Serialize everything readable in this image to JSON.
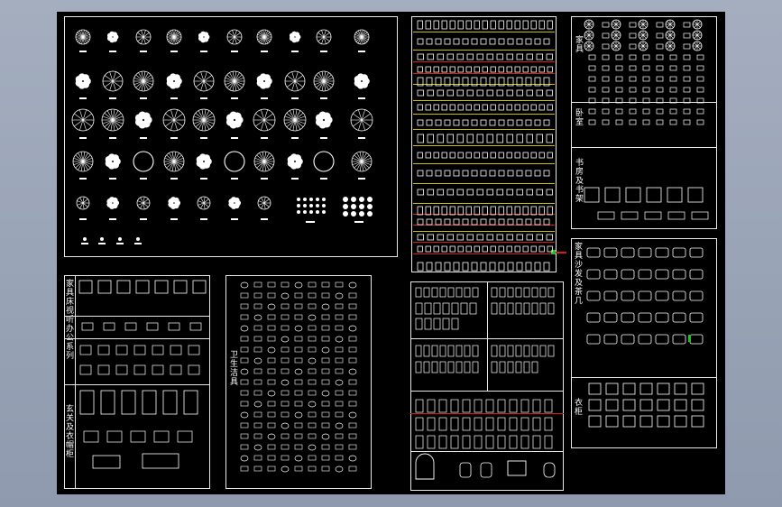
{
  "app": {
    "background": "#a4aebf",
    "canvas_color": "#000000"
  },
  "colors": {
    "line": "#e8e8e8",
    "yellow": "#c9c100",
    "red": "#d21c1c",
    "green": "#20c020"
  },
  "labels": {
    "furniture_top": "家具",
    "bedroom": "卧室",
    "study": "书房及书架",
    "panel_bl": "家具床视听办公系列",
    "panel_bl_lower": "玄关及衣帽柜",
    "sanitary": "卫生洁具",
    "sofa_panel": "家具沙发及茶几",
    "wardrobe": "衣柜"
  },
  "icons": {
    "tree_plan": "tree-symbol-icon",
    "shrub_plan": "shrub-symbol-icon",
    "furniture_block": "furniture-block-icon",
    "door_window": "door-window-icon",
    "bathroom_fixture": "bathroom-fixture-icon",
    "sofa_set": "sofa-set-icon"
  }
}
